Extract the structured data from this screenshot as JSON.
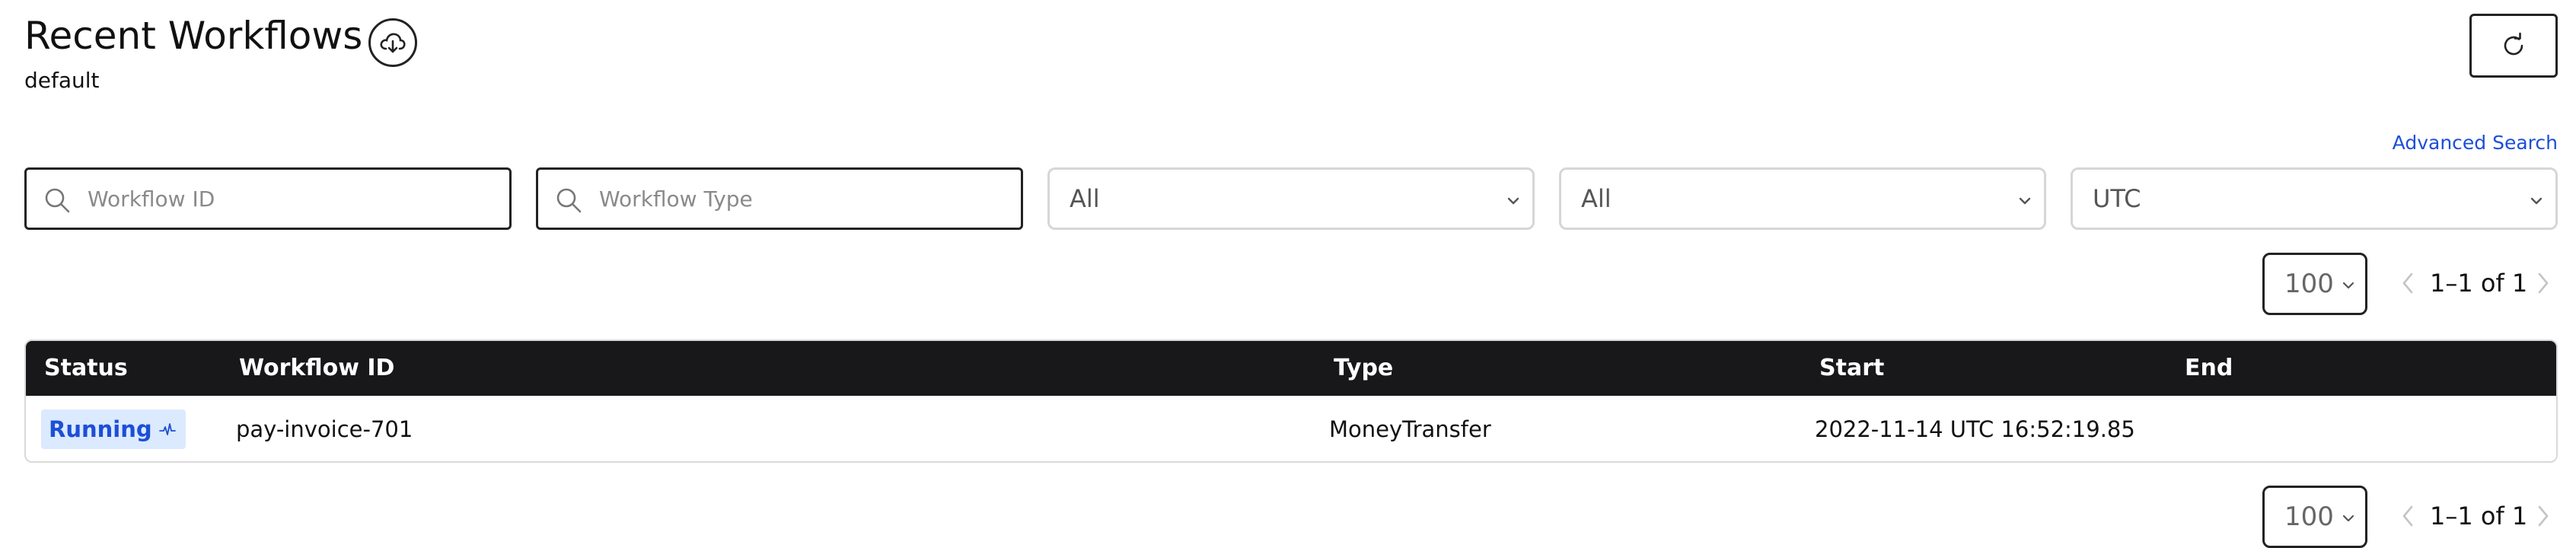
{
  "header": {
    "title": "Recent Workflows",
    "namespace": "default",
    "export_icon": "cloud-download-icon",
    "refresh_icon": "refresh-icon"
  },
  "advanced_search_link": "Advanced Search",
  "filters": {
    "workflow_id": {
      "placeholder": "Workflow ID",
      "value": ""
    },
    "workflow_type": {
      "placeholder": "Workflow Type",
      "value": ""
    },
    "status_select": "All",
    "time_range_select": "All",
    "timezone_select": "UTC"
  },
  "pagination": {
    "page_size": "100",
    "range_label": "1–1 of 1"
  },
  "table": {
    "columns": [
      "Status",
      "Workflow ID",
      "Type",
      "Start",
      "End"
    ],
    "rows": [
      {
        "status": "Running",
        "workflow_id": "pay-invoice-701",
        "type": "MoneyTransfer",
        "start": "2022-11-14 UTC 16:52:19.85",
        "end": ""
      }
    ]
  },
  "colors": {
    "accent": "#1d4ed8",
    "header_bg": "#18181b",
    "status_running_bg": "#dbeafe"
  }
}
